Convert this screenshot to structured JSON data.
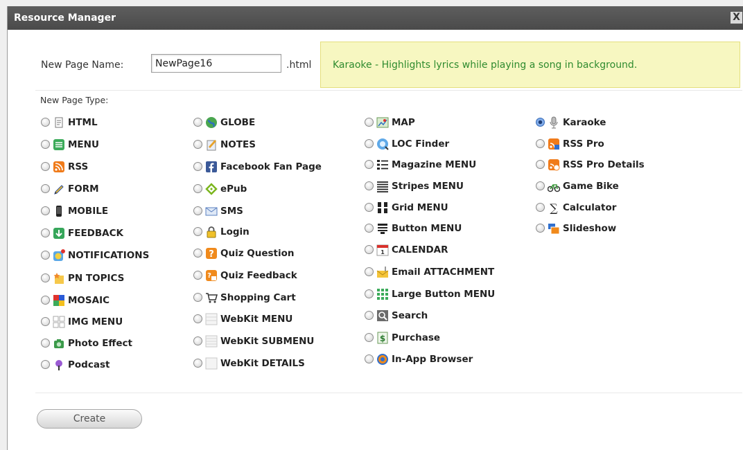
{
  "dialog": {
    "title": "Resource Manager",
    "close_glyph": "X"
  },
  "form": {
    "name_label": "New Page Name:",
    "name_value": "NewPage16",
    "extension": ".html",
    "type_label": "New Page Type:",
    "create_label": "Create"
  },
  "info": {
    "text": "Karaoke - Highlights lyrics while playing a song in background."
  },
  "selected_type": "Karaoke",
  "columns": [
    [
      {
        "label": "HTML",
        "icon": "document-icon",
        "checked": false
      },
      {
        "label": "MENU",
        "icon": "menu-list-icon",
        "checked": false
      },
      {
        "label": "RSS",
        "icon": "rss-icon",
        "checked": false
      },
      {
        "label": "FORM",
        "icon": "pencil-icon",
        "checked": false
      },
      {
        "label": "MOBILE",
        "icon": "phone-icon",
        "checked": false
      },
      {
        "label": "FEEDBACK",
        "icon": "download-arrow-icon",
        "checked": false
      },
      {
        "label": "NOTIFICATIONS",
        "icon": "smiley-badge-icon",
        "checked": false
      },
      {
        "label": "PN TOPICS",
        "icon": "star-note-icon",
        "checked": false
      },
      {
        "label": "MOSAIC",
        "icon": "mosaic-icon",
        "checked": false
      },
      {
        "label": "IMG MENU",
        "icon": "image-grid-icon",
        "checked": false
      },
      {
        "label": "Photo Effect",
        "icon": "camera-icon",
        "checked": false
      },
      {
        "label": "Podcast",
        "icon": "podcast-icon",
        "checked": false
      }
    ],
    [
      {
        "label": "GLOBE",
        "icon": "globe-icon",
        "checked": false
      },
      {
        "label": "NOTES",
        "icon": "notes-icon",
        "checked": false
      },
      {
        "label": "Facebook Fan Page",
        "icon": "facebook-icon",
        "checked": false
      },
      {
        "label": "ePub",
        "icon": "epub-icon",
        "checked": false
      },
      {
        "label": "SMS",
        "icon": "envelope-icon",
        "checked": false
      },
      {
        "label": "Login",
        "icon": "lock-icon",
        "checked": false
      },
      {
        "label": "Quiz Question",
        "icon": "quiz-question-icon",
        "checked": false
      },
      {
        "label": "Quiz Feedback",
        "icon": "quiz-feedback-icon",
        "checked": false
      },
      {
        "label": "Shopping Cart",
        "icon": "cart-icon",
        "checked": false
      },
      {
        "label": "WebKit MENU",
        "icon": "webkit-menu-icon",
        "checked": false
      },
      {
        "label": "WebKit SUBMENU",
        "icon": "webkit-submenu-icon",
        "checked": false
      },
      {
        "label": "WebKit DETAILS",
        "icon": "webkit-details-icon",
        "checked": false
      }
    ],
    [
      {
        "label": "MAP",
        "icon": "map-icon",
        "checked": false
      },
      {
        "label": "LOC Finder",
        "icon": "location-finder-icon",
        "checked": false
      },
      {
        "label": "Magazine MENU",
        "icon": "magazine-list-icon",
        "checked": false
      },
      {
        "label": "Stripes MENU",
        "icon": "stripes-icon",
        "checked": false
      },
      {
        "label": "Grid MENU",
        "icon": "grid-icon",
        "checked": false
      },
      {
        "label": "Button MENU",
        "icon": "button-menu-icon",
        "checked": false
      },
      {
        "label": "CALENDAR",
        "icon": "calendar-icon",
        "checked": false
      },
      {
        "label": "Email ATTACHMENT",
        "icon": "email-attachment-icon",
        "checked": false
      },
      {
        "label": "Large Button MENU",
        "icon": "large-grid-icon",
        "checked": false
      },
      {
        "label": "Search",
        "icon": "search-icon",
        "checked": false
      },
      {
        "label": "Purchase",
        "icon": "purchase-icon",
        "checked": false
      },
      {
        "label": "In-App Browser",
        "icon": "browser-icon",
        "checked": false
      }
    ],
    [
      {
        "label": "Karaoke",
        "icon": "microphone-icon",
        "checked": true
      },
      {
        "label": "RSS Pro",
        "icon": "rss-pro-icon",
        "checked": false
      },
      {
        "label": "RSS Pro Details",
        "icon": "rss-pro-details-icon",
        "checked": false
      },
      {
        "label": "Game Bike",
        "icon": "bike-icon",
        "checked": false
      },
      {
        "label": "Calculator",
        "icon": "sigma-icon",
        "checked": false
      },
      {
        "label": "Slideshow",
        "icon": "slideshow-icon",
        "checked": false
      }
    ]
  ]
}
